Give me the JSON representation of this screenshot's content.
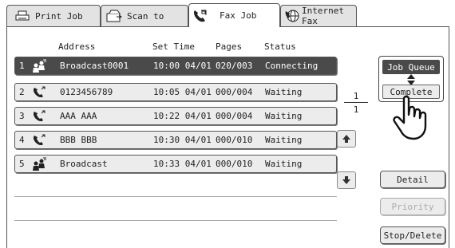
{
  "tabs": [
    {
      "label": "Print Job",
      "icon": "printer-icon"
    },
    {
      "label": "Scan to",
      "icon": "scanner-icon"
    },
    {
      "label": "Fax Job",
      "icon": "fax-phone-icon",
      "active": true
    },
    {
      "label": "Internet Fax",
      "icon": "internet-fax-icon"
    }
  ],
  "columns": {
    "address": "Address",
    "set_time": "Set Time",
    "pages": "Pages",
    "status": "Status"
  },
  "rows": [
    {
      "num": "1",
      "icon": "broadcast-icon",
      "address": "Broadcast0001",
      "time": "10:00 04/01",
      "pages": "020/003",
      "status": "Connecting",
      "selected": true
    },
    {
      "num": "2",
      "icon": "phone-icon",
      "address": "0123456789",
      "time": "10:05 04/01",
      "pages": "000/004",
      "status": "Waiting"
    },
    {
      "num": "3",
      "icon": "phone-icon",
      "address": "AAA AAA",
      "time": "10:22 04/01",
      "pages": "000/004",
      "status": "Waiting"
    },
    {
      "num": "4",
      "icon": "phone-icon",
      "address": "BBB BBB",
      "time": "10:30 04/01",
      "pages": "000/010",
      "status": "Waiting"
    },
    {
      "num": "5",
      "icon": "broadcast-icon",
      "address": "Broadcast",
      "time": "10:33 04/01",
      "pages": "000/010",
      "status": "Waiting"
    }
  ],
  "page_indicator": {
    "current": "1",
    "total": "1"
  },
  "job_queue": {
    "label": "Job Queue",
    "complete_label": "Complete"
  },
  "buttons": {
    "detail": "Detail",
    "priority": "Priority",
    "stop_delete": "Stop/Delete"
  },
  "colors": {
    "selected_row": "#4a4a4a",
    "button_bg": "#ececec",
    "border": "#555555"
  }
}
